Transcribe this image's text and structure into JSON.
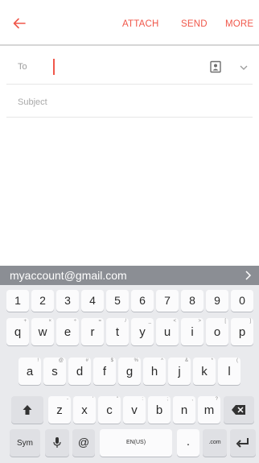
{
  "toolbar": {
    "back_icon": "arrow-left-icon",
    "attach_label": "ATTACH",
    "send_label": "SEND",
    "more_label": "MORE",
    "accent_color": "#f0574a"
  },
  "compose": {
    "to_label": "To",
    "to_value": "",
    "subject_placeholder": "Subject",
    "contact_icon": "contact-picker-icon",
    "expand_icon": "chevron-down-icon"
  },
  "suggestion": {
    "text": "myaccount@gmail.com",
    "arrow_icon": "chevron-right-icon"
  },
  "keyboard": {
    "numbers": [
      "1",
      "2",
      "3",
      "4",
      "5",
      "6",
      "7",
      "8",
      "9",
      "0"
    ],
    "row1": [
      {
        "key": "q",
        "hint": "+"
      },
      {
        "key": "w",
        "hint": "×"
      },
      {
        "key": "e",
        "hint": "÷"
      },
      {
        "key": "r",
        "hint": "="
      },
      {
        "key": "t",
        "hint": "/"
      },
      {
        "key": "y",
        "hint": "_"
      },
      {
        "key": "u",
        "hint": "<"
      },
      {
        "key": "i",
        "hint": ">"
      },
      {
        "key": "o",
        "hint": "["
      },
      {
        "key": "p",
        "hint": "]"
      }
    ],
    "row2": [
      {
        "key": "a",
        "hint": "!"
      },
      {
        "key": "s",
        "hint": "@"
      },
      {
        "key": "d",
        "hint": "#"
      },
      {
        "key": "f",
        "hint": "$"
      },
      {
        "key": "g",
        "hint": "%"
      },
      {
        "key": "h",
        "hint": "^"
      },
      {
        "key": "j",
        "hint": "&"
      },
      {
        "key": "k",
        "hint": "*"
      },
      {
        "key": "l",
        "hint": "("
      }
    ],
    "row3": [
      {
        "key": "z",
        "hint": "-"
      },
      {
        "key": "x",
        "hint": "'"
      },
      {
        "key": "c",
        "hint": "\""
      },
      {
        "key": "v",
        "hint": ":"
      },
      {
        "key": "b",
        "hint": ";"
      },
      {
        "key": "n",
        "hint": ","
      },
      {
        "key": "m",
        "hint": "?"
      }
    ],
    "shift_icon": "shift-arrow-icon",
    "backspace_icon": "backspace-icon",
    "sym_label": "Sym",
    "mic_icon": "microphone-icon",
    "at_label": "@",
    "space_label": "EN(US)",
    "period_label": ".",
    "dotcom_label": ".com",
    "enter_icon": "enter-icon"
  }
}
